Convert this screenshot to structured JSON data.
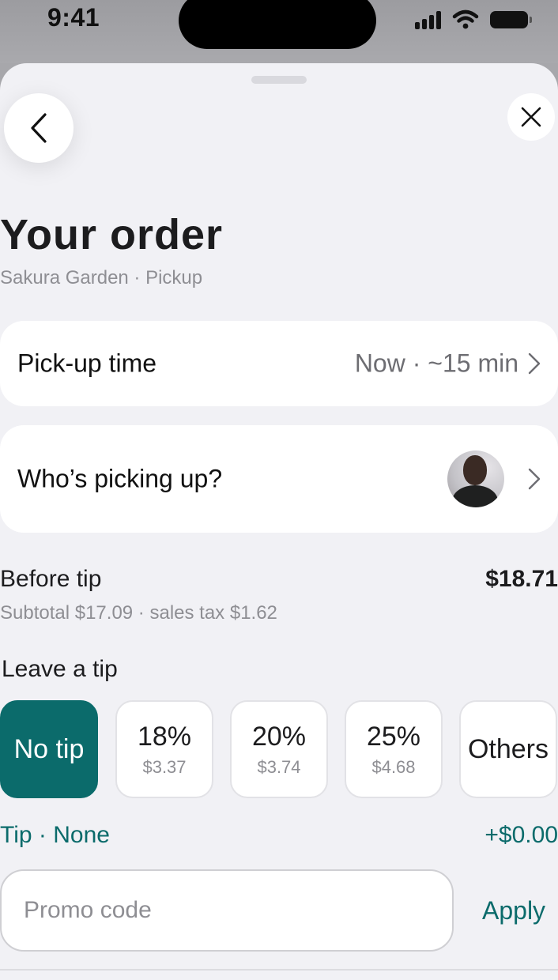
{
  "status_bar": {
    "time": "9:41"
  },
  "header": {
    "back_icon": "chevron-left-icon",
    "close_icon": "close-icon",
    "title": "Your order",
    "subtitle": "Sakura Garden · Pickup"
  },
  "pickup_time": {
    "label": "Pick-up time",
    "value": "Now · ~15 min"
  },
  "picker": {
    "label": "Who’s picking up?"
  },
  "summary": {
    "before_tip_label": "Before tip",
    "before_tip_amount": "$18.71",
    "breakdown": "Subtotal $17.09 · sales tax $1.62"
  },
  "tip": {
    "heading": "Leave a tip",
    "options": [
      {
        "label": "No tip",
        "selected": true
      },
      {
        "percent": "18%",
        "amount": "$3.37",
        "selected": false
      },
      {
        "percent": "20%",
        "amount": "$3.74",
        "selected": false
      },
      {
        "percent": "25%",
        "amount": "$4.68",
        "selected": false
      },
      {
        "label": "Others",
        "selected": false
      }
    ],
    "status": "Tip · None",
    "added": "+$0.00"
  },
  "promo": {
    "placeholder": "Promo code",
    "value": "",
    "apply_label": "Apply"
  },
  "colors": {
    "accent": "#0b6b6b",
    "background": "#f1f1f5",
    "card": "#ffffff"
  }
}
